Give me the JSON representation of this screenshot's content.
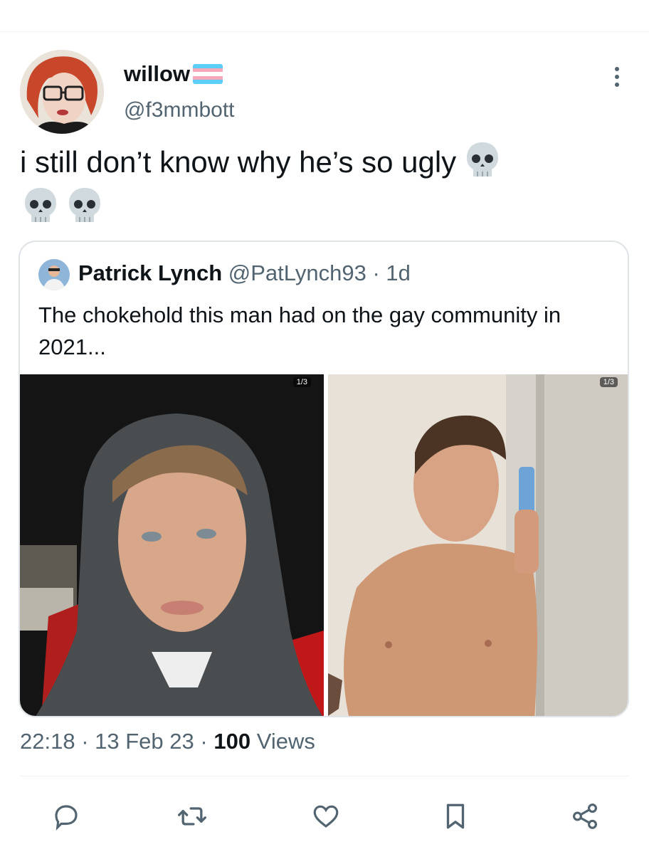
{
  "tweet": {
    "author": {
      "display_name": "willow",
      "handle": "@f3mmbott"
    },
    "text": "i still don’t know why he’s so ugly",
    "emoji": "skull",
    "timestamp": {
      "time": "22:18",
      "sep1": "·",
      "date": "13 Feb 23",
      "sep2": "·",
      "views_count": "100",
      "views_label": "Views"
    }
  },
  "quote": {
    "display_name": "Patrick Lynch",
    "handle": "@PatLynch93",
    "sep": "·",
    "age": "1d",
    "text": "The chokehold this man had on the gay community in 2021...",
    "media": [
      {
        "badge": "1/3"
      },
      {
        "badge": "1/3"
      }
    ]
  },
  "actions": [
    "reply-icon",
    "retweet-icon",
    "like-icon",
    "bookmark-icon",
    "share-icon"
  ],
  "colors": {
    "text_primary": "#0f1419",
    "text_secondary": "#536471",
    "border": "#dfe4e8",
    "flag_blue": "#5bcefa",
    "flag_pink": "#f5a9b8",
    "flag_white": "#ffffff"
  }
}
